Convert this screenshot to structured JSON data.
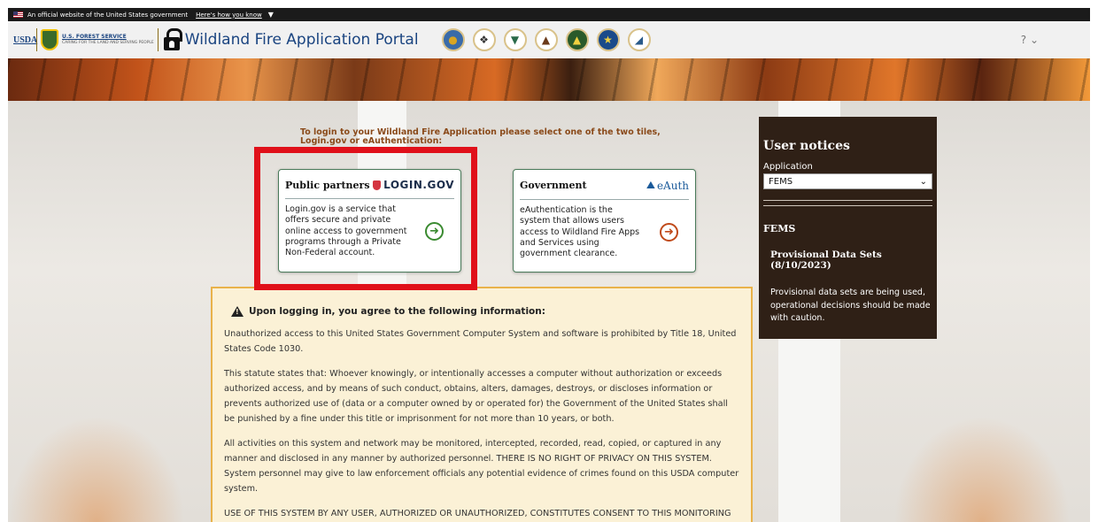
{
  "gov_banner": {
    "text": "An official website of the United States government",
    "link": "Here's how you know"
  },
  "header": {
    "usda": "USDA",
    "forest_service": "U.S. FOREST SERVICE",
    "forest_tagline": "CARING FOR THE LAND AND SERVING PEOPLE",
    "portal_title": "Wildland Fire Application Portal",
    "agency_icons": [
      "bia-icon",
      "bia-eagle-icon",
      "blm-icon",
      "nps-icon",
      "usfs-tree-icon",
      "dod-icon",
      "usfws-icon"
    ],
    "help": "?"
  },
  "login": {
    "prompt": "To login to your Wildland Fire Application please select one of the two tiles, Login.gov or eAuthentication:",
    "public": {
      "title": "Public partners",
      "logo": "LOGIN.GOV",
      "text": "Login.gov is a service that offers secure and private online access to government programs through a Private Non-Federal account."
    },
    "government": {
      "title": "Government",
      "logo": "eAuth",
      "text": "eAuthentication is the system that allows users access to Wildland Fire Apps and Services using government clearance."
    }
  },
  "notices": {
    "title": "User notices",
    "app_label": "Application",
    "app_selected": "FEMS",
    "section": "FEMS",
    "notice_title": "Provisional Data Sets (8/10/2023)",
    "notice_text": "Provisional data sets are being used, operational decisions should be made with caution."
  },
  "disclaimer": {
    "heading": "Upon logging in, you agree to the following information:",
    "paragraphs": [
      "Unauthorized access to this United States Government Computer System and software is prohibited by Title 18, United States Code 1030.",
      "This statute states that: Whoever knowingly, or intentionally accesses a computer without authorization or exceeds authorized access, and by means of such conduct, obtains, alters, damages, destroys, or discloses information or prevents authorized use of (data or a computer owned by or operated for) the Government of the United States shall be punished by a fine under this title or imprisonment for not more than 10 years, or both.",
      "All activities on this system and network may be monitored, intercepted, recorded, read, copied, or captured in any manner and disclosed in any manner by authorized personnel. THERE IS NO RIGHT OF PRIVACY ON THIS SYSTEM. System personnel may give to law enforcement officials any potential evidence of crimes found on this USDA computer system.",
      "USE OF THIS SYSTEM BY ANY USER, AUTHORIZED OR UNAUTHORIZED, CONSTITUTES CONSENT TO THIS MONITORING"
    ]
  },
  "colors": {
    "highlight": "#e0101a",
    "notices_bg": "#2f2016",
    "disclaimer_bg": "#fbf1d6",
    "disclaimer_border": "#e9b24a",
    "login_arrow": "#3a8a30",
    "eauth_arrow": "#c04a1a"
  }
}
